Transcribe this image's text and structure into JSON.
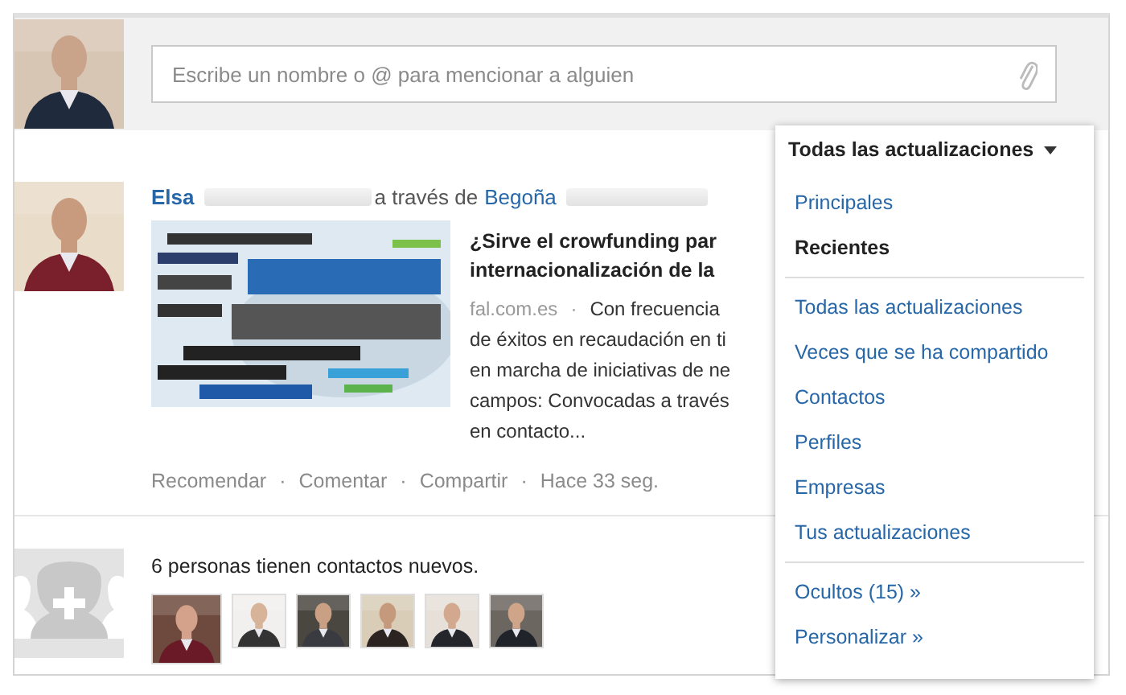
{
  "composer": {
    "placeholder": "Escribe un nombre o @ para mencionar a alguien"
  },
  "feed": [
    {
      "kind": "share",
      "author": "Elsa",
      "via": "a través de",
      "via_author": "Begoña",
      "title_lines": [
        "¿Sirve el crowfunding par",
        "internacionalización de la"
      ],
      "source": "fal.com.es",
      "separator": "·",
      "body_lines": [
        "Con frecuencia",
        "de éxitos en recaudación en ti",
        "en marcha de iniciativas de ne",
        "campos: Convocadas a través",
        "en contacto..."
      ],
      "actions": [
        "Recomendar",
        "Comentar",
        "Compartir"
      ],
      "time": "Hace 33 seg."
    },
    {
      "kind": "connections",
      "text": "6 personas tienen contactos nuevos."
    }
  ],
  "filter_menu": {
    "label": "Todas las actualizaciones",
    "groups": [
      [
        {
          "label": "Principales",
          "selected": false
        },
        {
          "label": "Recientes",
          "selected": true
        }
      ],
      [
        {
          "label": "Todas las actualizaciones",
          "selected": false
        },
        {
          "label": "Veces que se ha compartido",
          "selected": false
        },
        {
          "label": "Contactos",
          "selected": false
        },
        {
          "label": "Perfiles",
          "selected": false
        },
        {
          "label": "Empresas",
          "selected": false
        },
        {
          "label": "Tus actualizaciones",
          "selected": false
        }
      ],
      [
        {
          "label": "Ocultos (15) »",
          "selected": false
        },
        {
          "label": "Personalizar »",
          "selected": false
        }
      ]
    ]
  }
}
